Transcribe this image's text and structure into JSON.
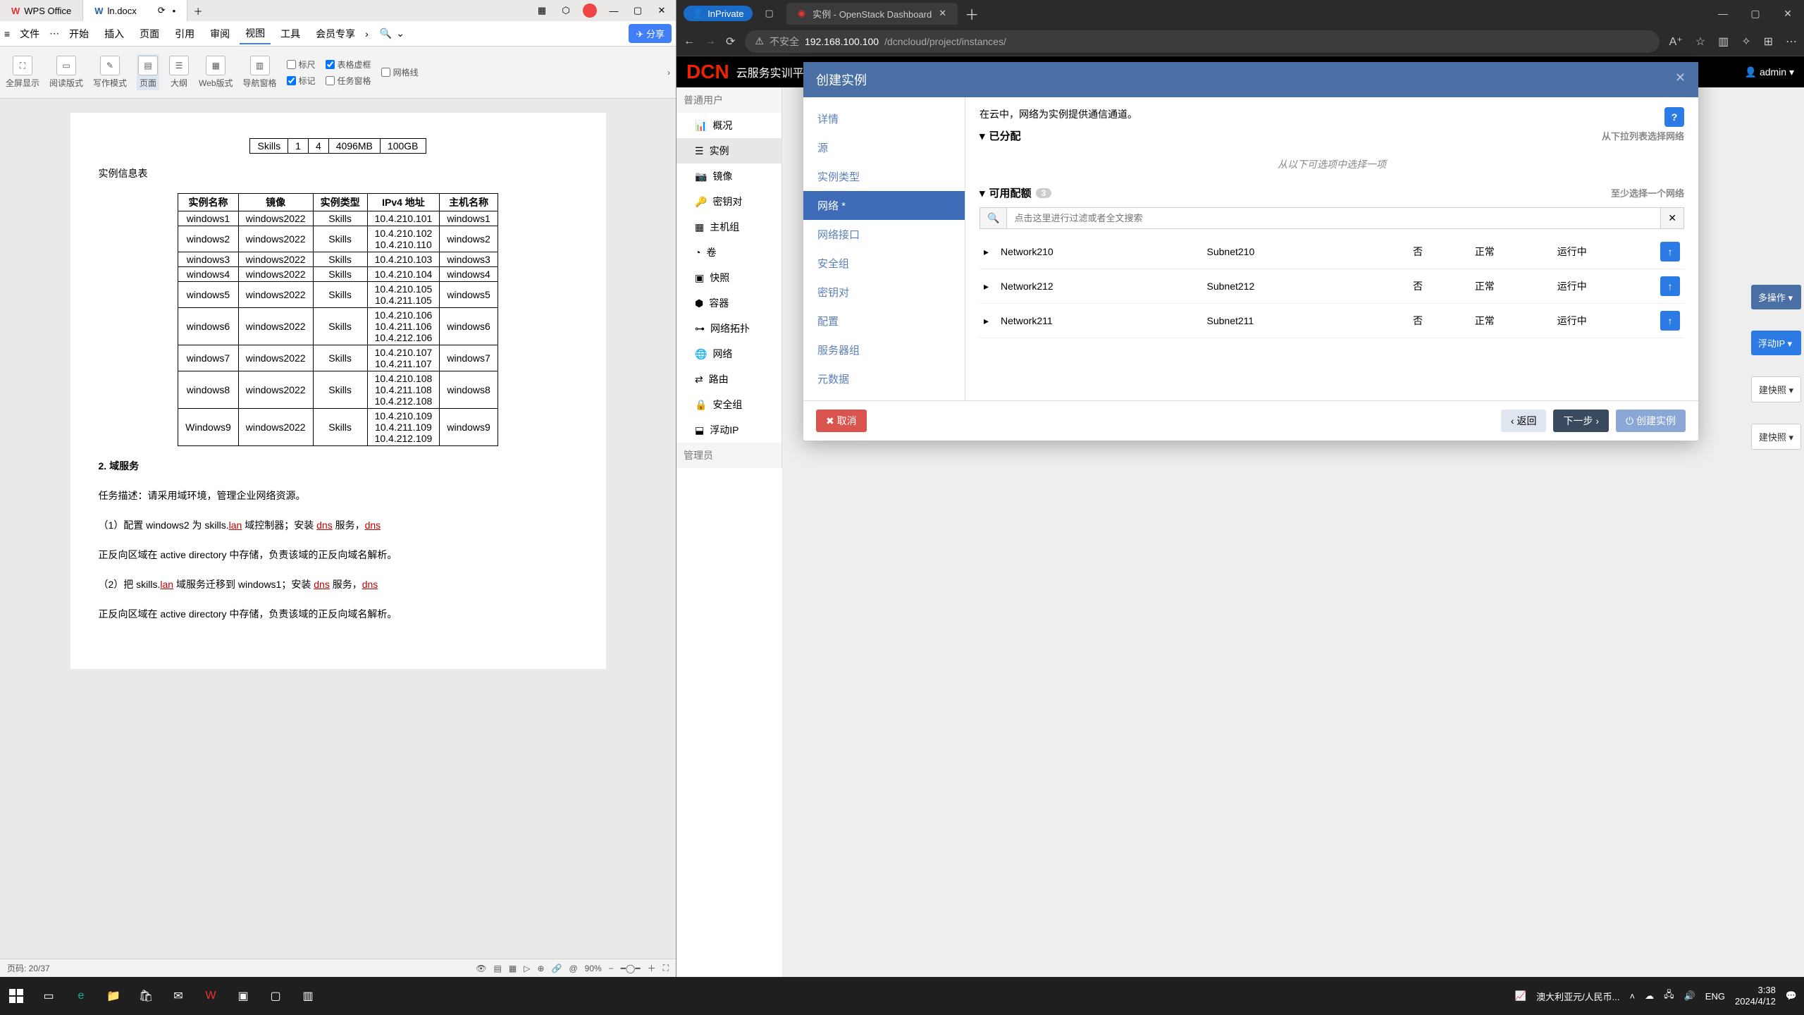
{
  "wps": {
    "app_tab": "WPS Office",
    "doc_tab": "ln.docx",
    "menu": {
      "file": "文件",
      "start": "开始",
      "insert": "插入",
      "page": "页面",
      "ref": "引用",
      "review": "审阅",
      "view": "视图",
      "tool": "工具",
      "member": "会员专享"
    },
    "share": "分享",
    "tools": {
      "fullscreen": "全屏显示",
      "read": "阅读版式",
      "write": "写作模式",
      "pagev": "页面",
      "outline": "大纲",
      "web": "Web版式",
      "navpane": "导航窗格"
    },
    "checks": {
      "ruler": "标尺",
      "tblgrid": "表格虚框",
      "grid": "网格线",
      "marks": "标记",
      "taskpane": "任务窗格"
    },
    "table1": {
      "c1": "Skills",
      "c2": "1",
      "c3": "4",
      "c4": "4096MB",
      "c5": "100GB"
    },
    "tbl_caption": "实例信息表",
    "tbl_headers": [
      "实例名称",
      "镜像",
      "实例类型",
      "IPv4 地址",
      "主机名称"
    ],
    "rows": [
      {
        "n": "windows1",
        "i": "windows2022",
        "t": "Skills",
        "ip": [
          "10.4.210.101"
        ],
        "h": "windows1"
      },
      {
        "n": "windows2",
        "i": "windows2022",
        "t": "Skills",
        "ip": [
          "10.4.210.102",
          "10.4.210.110"
        ],
        "h": "windows2"
      },
      {
        "n": "windows3",
        "i": "windows2022",
        "t": "Skills",
        "ip": [
          "10.4.210.103"
        ],
        "h": "windows3"
      },
      {
        "n": "windows4",
        "i": "windows2022",
        "t": "Skills",
        "ip": [
          "10.4.210.104"
        ],
        "h": "windows4"
      },
      {
        "n": "windows5",
        "i": "windows2022",
        "t": "Skills",
        "ip": [
          "10.4.210.105",
          "10.4.211.105"
        ],
        "h": "windows5"
      },
      {
        "n": "windows6",
        "i": "windows2022",
        "t": "Skills",
        "ip": [
          "10.4.210.106",
          "10.4.211.106",
          "10.4.212.106"
        ],
        "h": "windows6"
      },
      {
        "n": "windows7",
        "i": "windows2022",
        "t": "Skills",
        "ip": [
          "10.4.210.107",
          "10.4.211.107"
        ],
        "h": "windows7"
      },
      {
        "n": "windows8",
        "i": "windows2022",
        "t": "Skills",
        "ip": [
          "10.4.210.108",
          "10.4.211.108",
          "10.4.212.108"
        ],
        "h": "windows8"
      },
      {
        "n": "Windows9",
        "i": "windows2022",
        "t": "Skills",
        "ip": [
          "10.4.210.109",
          "10.4.211.109",
          "10.4.212.109"
        ],
        "h": "windows9"
      }
    ],
    "section2": "2. 域服务",
    "p1a": "任务描述：请采用域环境，管理企业网络资源。",
    "p2a": "（1）配置 windows2 为 skills.",
    "p2b": "lan",
    "p2c": " 域控制器；安装 ",
    "p2d": "dns",
    "p2e": " 服务，",
    "p2f": "dns",
    "p3": "正反向区域在 active directory 中存储，负责该域的正反向域名解析。",
    "p4a": "（2）把 skills.",
    "p4b": "lan",
    "p4c": " 域服务迁移到 windows1；安装 ",
    "p4d": "dns",
    "p4e": " 服务，",
    "p4f": "dns",
    "p5": "正反向区域在 active directory 中存储，负责该域的正反向域名解析。",
    "status_page": "页码: 20/37",
    "status_zoom": "90%"
  },
  "edge": {
    "inprivate": "InPrivate",
    "tab_title": "实例 - OpenStack Dashboard",
    "insecure": "不安全",
    "url_host": "192.168.100.100",
    "url_path": "/dcncloud/project/instances/"
  },
  "openstack": {
    "platform": "云服务实训平台",
    "logo": "DCN",
    "admin": "admin",
    "side_group1": "普通用户",
    "side_group2": "管理员",
    "side": {
      "overview": "概况",
      "instances": "实例",
      "images": "镜像",
      "keypairs": "密钥对",
      "hostgroup": "主机组",
      "volumes": "卷",
      "snapshots": "快照",
      "containers": "容器",
      "nettopo": "网络拓扑",
      "networks": "网络",
      "routers": "路由",
      "secgroups": "安全组",
      "floatip": "浮动IP"
    },
    "obs": {
      "more": "多操作 ▾",
      "fip": "浮动IP ▾",
      "snap1": "建快照 ▾",
      "snap2": "建快照 ▾"
    }
  },
  "modal": {
    "title": "创建实例",
    "wizard": {
      "detail": "详情",
      "source": "源",
      "flavor": "实例类型",
      "network": "网络 *",
      "netport": "网络接口",
      "secgroup": "安全组",
      "keypair": "密钥对",
      "config": "配置",
      "servergroup": "服务器组",
      "metadata": "元数据"
    },
    "desc": "在云中，网络为实例提供通信通道。",
    "alloc": "已分配",
    "alloc_hint": "从下拉列表选择网络",
    "empty": "从以下可选项中选择一项",
    "avail": "可用配额",
    "avail_badge": "3",
    "avail_hint": "至少选择一个网络",
    "search_ph": "点击这里进行过滤或者全文搜索",
    "nets": [
      {
        "name": "Network210",
        "subnet": "Subnet210",
        "shared": "否",
        "state": "正常",
        "status": "运行中"
      },
      {
        "name": "Network212",
        "subnet": "Subnet212",
        "shared": "否",
        "state": "正常",
        "status": "运行中"
      },
      {
        "name": "Network211",
        "subnet": "Subnet211",
        "shared": "否",
        "state": "正常",
        "status": "运行中"
      }
    ],
    "btn_cancel": "✖ 取消",
    "btn_back": "‹ 返回",
    "btn_next": "下一步 ›",
    "btn_create": "创建实例"
  },
  "taskbar": {
    "currency": "澳大利亚元/人民币...",
    "ime": "ENG",
    "time": "3:38",
    "date": "2024/4/12"
  }
}
